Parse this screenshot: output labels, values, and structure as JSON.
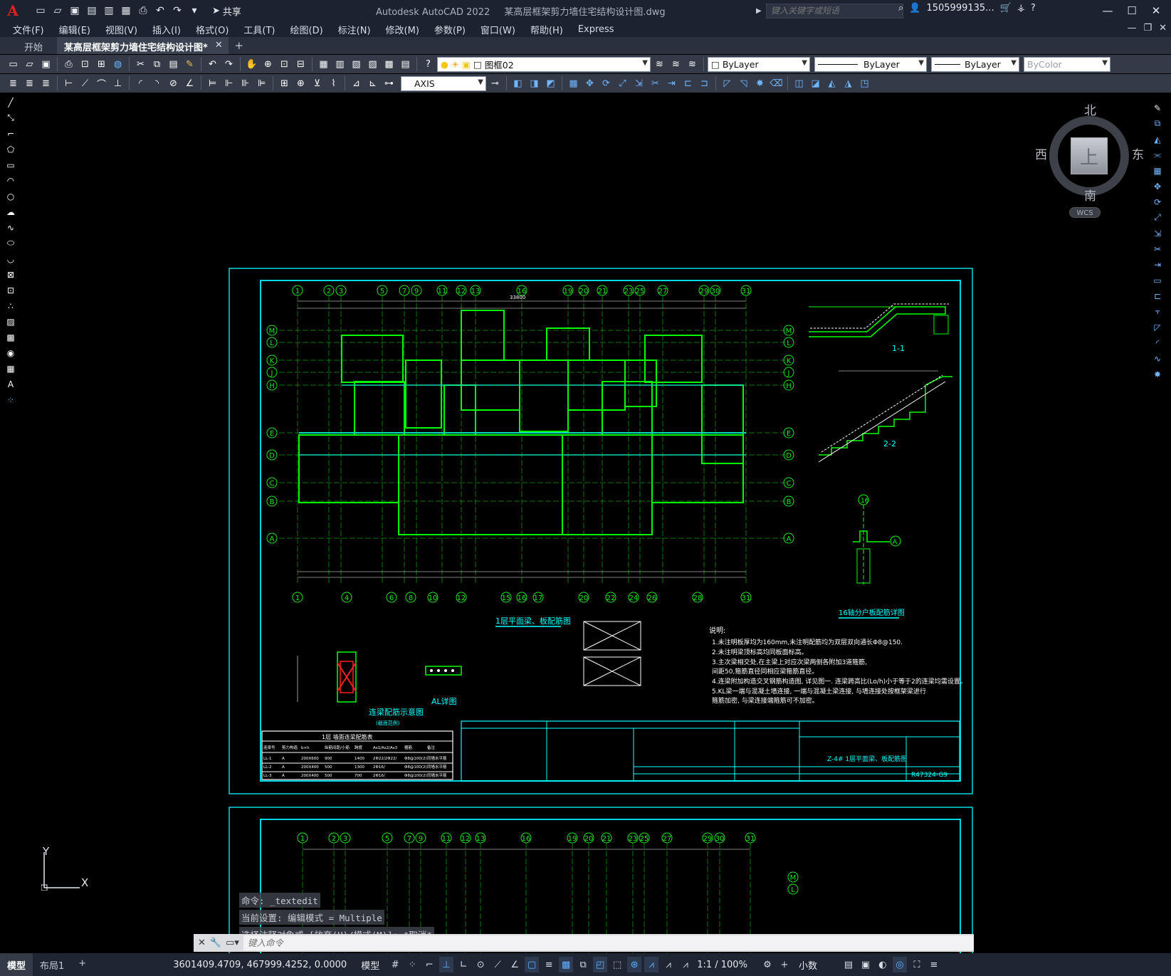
{
  "app": {
    "title": "Autodesk AutoCAD 2022",
    "document": "某高层框架剪力墙住宅结构设计图.dwg",
    "share_label": "共享",
    "search_placeholder": "键入关键字或短语",
    "user": "1505999135...",
    "logo": "A"
  },
  "menus": [
    "文件(F)",
    "编辑(E)",
    "视图(V)",
    "插入(I)",
    "格式(O)",
    "工具(T)",
    "绘图(D)",
    "标注(N)",
    "修改(M)",
    "参数(P)",
    "窗口(W)",
    "帮助(H)",
    "Express"
  ],
  "tabs": {
    "start": "开始",
    "active": "某高层框架剪力墙住宅结构设计图*"
  },
  "toolbar": {
    "layer_name": "图框02",
    "color": "ByLayer",
    "linetype": "ByLayer",
    "lineweight": "ByLayer",
    "plotstyle": "ByColor",
    "dimstyle": "AXIS"
  },
  "viewcube": {
    "north": "北",
    "south": "南",
    "west": "西",
    "east": "东",
    "face": "上",
    "wcs": "WCS"
  },
  "ucs": {
    "x": "X",
    "y": "Y"
  },
  "command": {
    "history": [
      "命令:  _textedit",
      "当前设置: 编辑模式 = Multiple",
      "选择注释对象或 [放弃(U)/模式(M)]: *取消*"
    ],
    "placeholder": "键入命令"
  },
  "status": {
    "layouts": [
      "模型",
      "布局1"
    ],
    "coords": "3601409.4709, 467999.4252, 0.0000",
    "model": "模型",
    "scale": "1:1 / 100%",
    "units": "小数"
  },
  "drawing": {
    "axes_top": [
      "1",
      "2",
      "3",
      "5",
      "7",
      "9",
      "11",
      "12",
      "13",
      "16",
      "19",
      "20",
      "21",
      "23",
      "25",
      "27",
      "29",
      "30",
      "31"
    ],
    "axes_bottom": [
      "1",
      "4",
      "6",
      "8",
      "10",
      "12",
      "15",
      "16",
      "17",
      "20",
      "22",
      "24",
      "26",
      "28",
      "31"
    ],
    "axes_side": [
      "M",
      "L",
      "K",
      "J",
      "H",
      "E",
      "D",
      "C",
      "B",
      "A"
    ],
    "title_main": "1层平面梁、板配筋图",
    "title_section_1": "1-1",
    "title_section_2": "2-2",
    "title_detail_16": "16轴分户板配筋详图",
    "title_lianliang": "连梁配筋示意图",
    "subtitle_lianliang": "(截面范例)",
    "title_al": "AL详图",
    "notes_heading": "说明:",
    "notes": [
      "1.未注明板厚均为160mm,未注明配筋均为双层双向通长Φ8@150.",
      "2.未注明梁顶标高均同板面标高。",
      "3.主次梁相交处,在主梁上对应次梁两侧各附加3道箍筋,",
      "   间距50,箍筋直径同相应梁箍筋直径。",
      "4.连梁附加构造交叉钢筋构造图, 详见图一. 连梁跨高比(Lo/h)小于等于2的连梁均需设置。",
      "5.KL梁一端与混凝土墙连接, 一端与混凝土梁连接, 与墙连接处按框架梁进行",
      "   箍筋加密, 与梁连接端箍筋可不加密。"
    ],
    "table_title": "1层 墙面连梁配筋表",
    "table_headers": [
      "连梁号",
      "剪力构造",
      "b×h",
      "纵筋间距/小筋",
      "跨度",
      "As1/As2/As3",
      "箍筋",
      "备注"
    ],
    "table_rows": [
      [
        "LL-1",
        "A",
        "200X600",
        "900",
        "1400",
        "2Φ22/2Φ22/",
        "Φ8@100(2)",
        "同墙水平筋"
      ],
      [
        "LL-2",
        "A",
        "200X400",
        "500",
        "1300",
        "2Φ16/",
        "Φ8@100(2)",
        "同墙水平筋"
      ],
      [
        "LL-3",
        "A",
        "200X400",
        "500",
        "700",
        "2Φ16/",
        "Φ8@100(2)",
        "同墙水平筋"
      ]
    ],
    "titleblock_drawing_no": "R47324-G9",
    "titleblock_name": "Z-4# 1层平面梁、板配筋图",
    "dim_total": "33800"
  },
  "colors": {
    "frame": "#00d8e0",
    "grid": "#19e619",
    "wall": "#00ff00",
    "beam": "#00d8e0",
    "text": "#ffffff",
    "dim": "#00ffff",
    "red": "#ff2020",
    "background": "#000000"
  }
}
